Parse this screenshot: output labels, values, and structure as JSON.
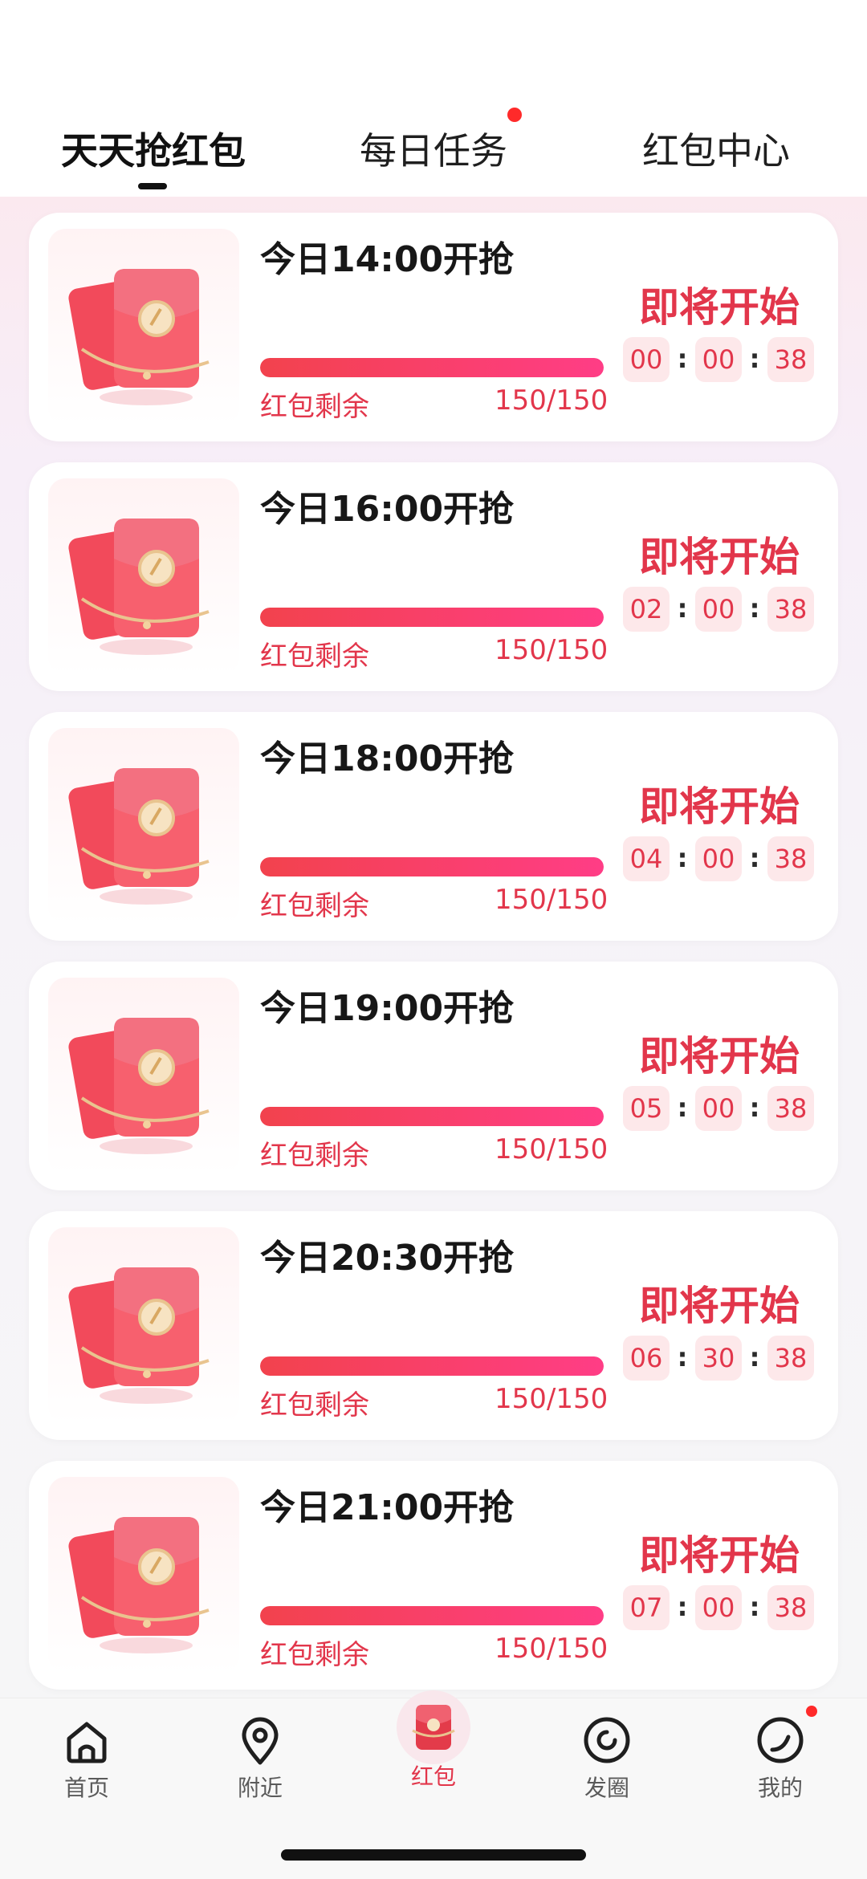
{
  "tabs": [
    {
      "label": "天天抢红包",
      "active": true
    },
    {
      "label": "每日任务",
      "active": false,
      "badge_dot": true
    },
    {
      "label": "红包中心",
      "active": false
    }
  ],
  "cards": [
    {
      "title": "今日14:00开抢",
      "status": "即将开始",
      "remain_label": "红包剩余",
      "remain_count": "150/150",
      "progress": 1.0,
      "countdown": [
        "00",
        "00",
        "38"
      ]
    },
    {
      "title": "今日16:00开抢",
      "status": "即将开始",
      "remain_label": "红包剩余",
      "remain_count": "150/150",
      "progress": 1.0,
      "countdown": [
        "02",
        "00",
        "38"
      ]
    },
    {
      "title": "今日18:00开抢",
      "status": "即将开始",
      "remain_label": "红包剩余",
      "remain_count": "150/150",
      "progress": 1.0,
      "countdown": [
        "04",
        "00",
        "38"
      ]
    },
    {
      "title": "今日19:00开抢",
      "status": "即将开始",
      "remain_label": "红包剩余",
      "remain_count": "150/150",
      "progress": 1.0,
      "countdown": [
        "05",
        "00",
        "38"
      ]
    },
    {
      "title": "今日20:30开抢",
      "status": "即将开始",
      "remain_label": "红包剩余",
      "remain_count": "150/150",
      "progress": 1.0,
      "countdown": [
        "06",
        "30",
        "38"
      ]
    },
    {
      "title": "今日21:00开抢",
      "status": "即将开始",
      "remain_label": "红包剩余",
      "remain_count": "150/150",
      "progress": 1.0,
      "countdown": [
        "07",
        "00",
        "38"
      ]
    }
  ],
  "countdown_separator": ":",
  "bottom_nav": [
    {
      "label": "首页",
      "icon": "home-icon"
    },
    {
      "label": "附近",
      "icon": "location-pin-icon"
    },
    {
      "label": "红包",
      "icon": "red-packet-icon",
      "active": true
    },
    {
      "label": "发圈",
      "icon": "moments-icon"
    },
    {
      "label": "我的",
      "icon": "profile-icon",
      "badge_dot": true
    }
  ],
  "colors": {
    "accent": "#e2364b",
    "progress_start": "#f2424d",
    "progress_end": "#ff3d86",
    "countdown_bg": "#fde8ea"
  }
}
